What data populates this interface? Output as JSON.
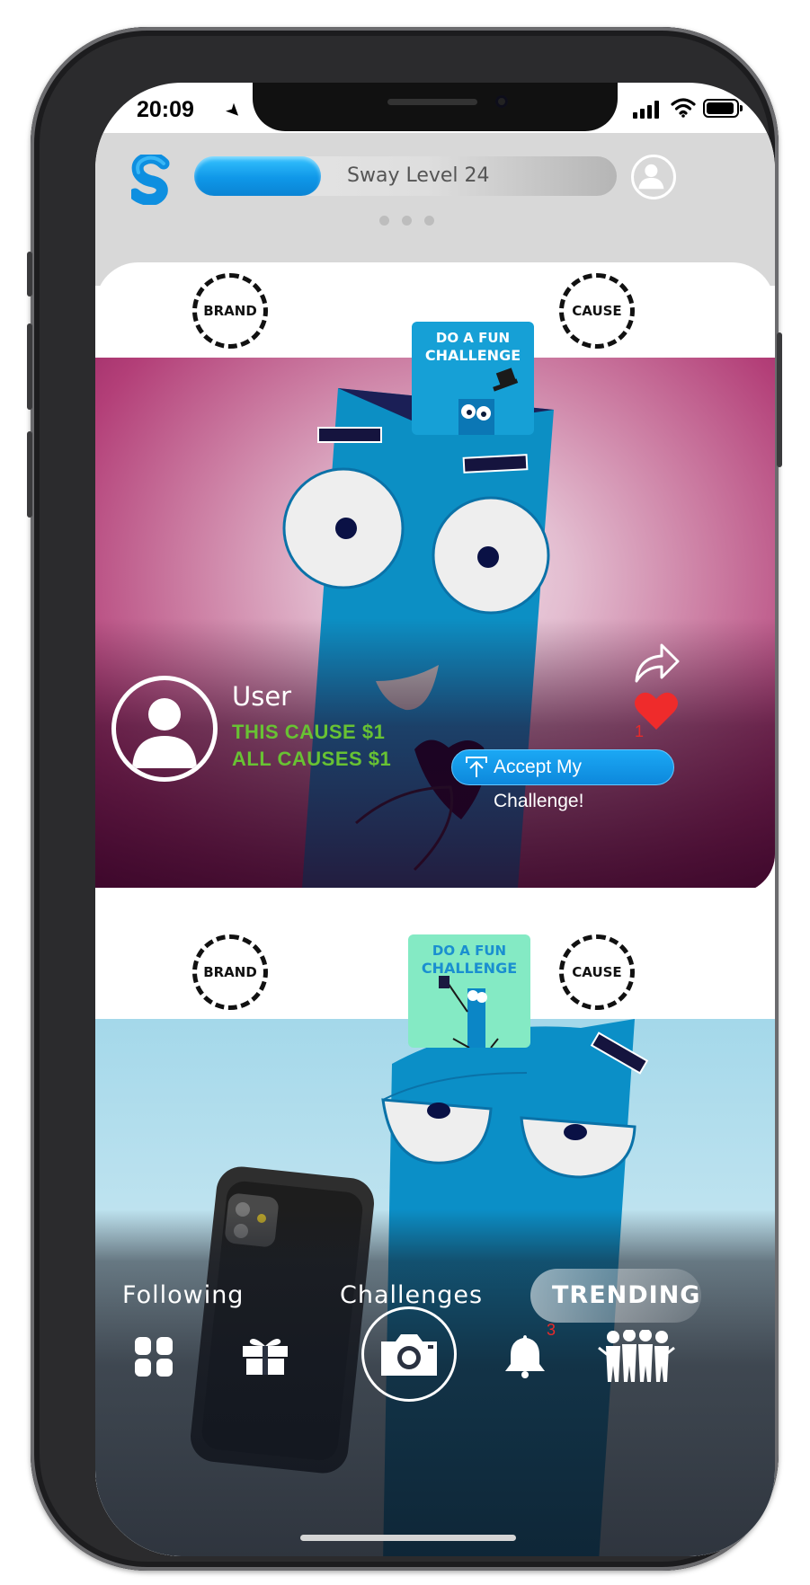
{
  "status_bar": {
    "time": "20:09"
  },
  "header": {
    "level_label": "Sway Level 24",
    "level_progress": 0.3,
    "accent_color": "#0f97e8"
  },
  "posts": [
    {
      "brand_label": "BRAND",
      "cause_label": "CAUSE",
      "challenge_line1": "DO A FUN",
      "challenge_line2": "CHALLENGE",
      "user_name": "User",
      "this_cause": "THIS CAUSE $1",
      "all_causes": "ALL CAUSES $1",
      "like_count": "1",
      "accept_label": "Accept My Challenge!"
    },
    {
      "brand_label": "BRAND",
      "cause_label": "CAUSE",
      "challenge_line1": "DO A FUN",
      "challenge_line2": "CHALLENGE"
    }
  ],
  "nav": {
    "tabs": [
      "Following",
      "Challenges",
      "TRENDING"
    ],
    "active_tab": "TRENDING",
    "notification_count": "3",
    "icons": [
      "grid-icon",
      "gift-icon",
      "camera-icon",
      "bell-icon",
      "people-icon"
    ]
  }
}
